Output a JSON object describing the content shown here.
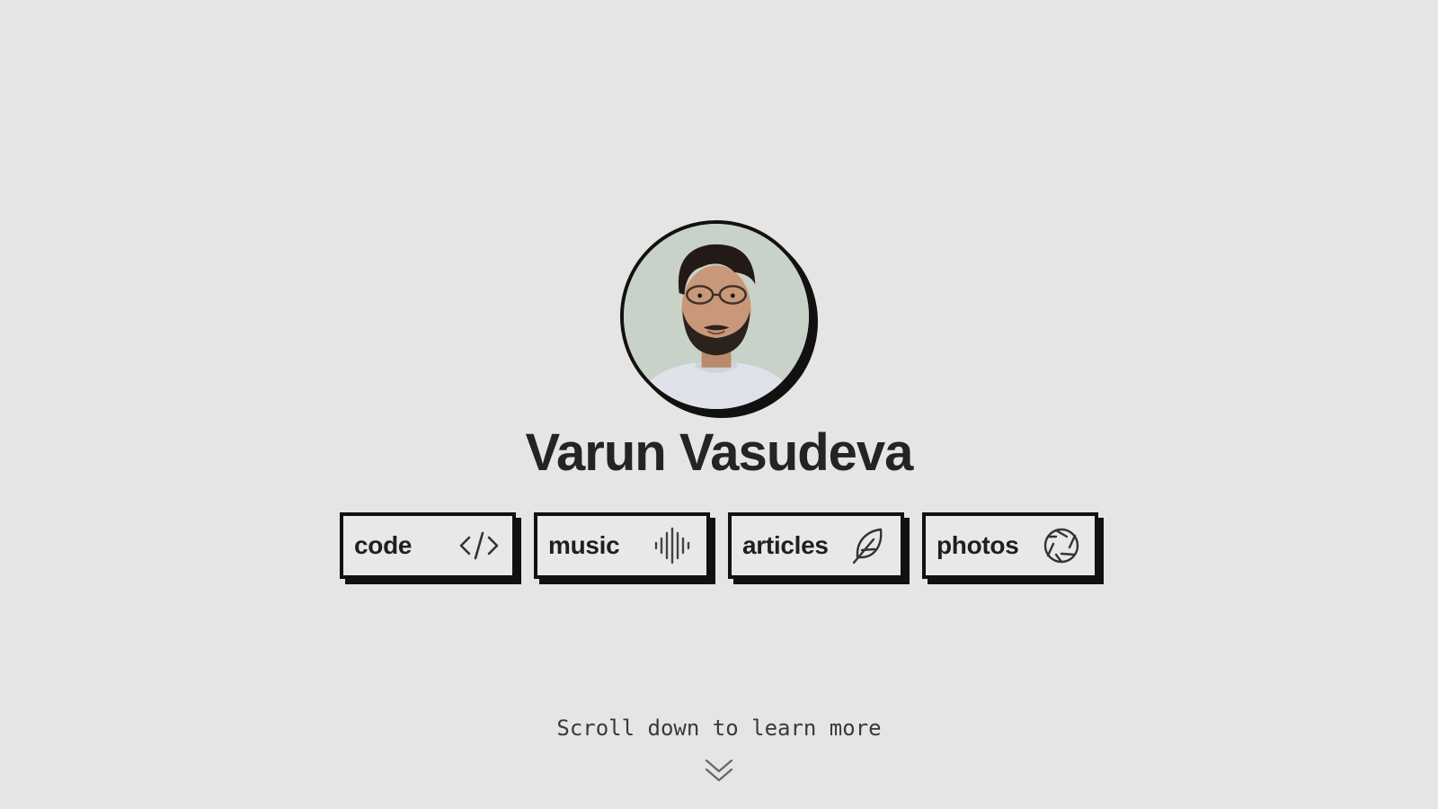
{
  "profile": {
    "name": "Varun Vasudeva",
    "avatar_alt": "profile photo"
  },
  "links": [
    {
      "label": "code",
      "icon": "code-icon"
    },
    {
      "label": "music",
      "icon": "waveform-icon"
    },
    {
      "label": "articles",
      "icon": "feather-icon"
    },
    {
      "label": "photos",
      "icon": "aperture-icon"
    }
  ],
  "scroll": {
    "text": "Scroll down to learn more",
    "icon": "double-chevron-down-icon"
  },
  "colors": {
    "background": "#e7e5e3",
    "border": "#111111",
    "text": "#1f1f1f"
  }
}
